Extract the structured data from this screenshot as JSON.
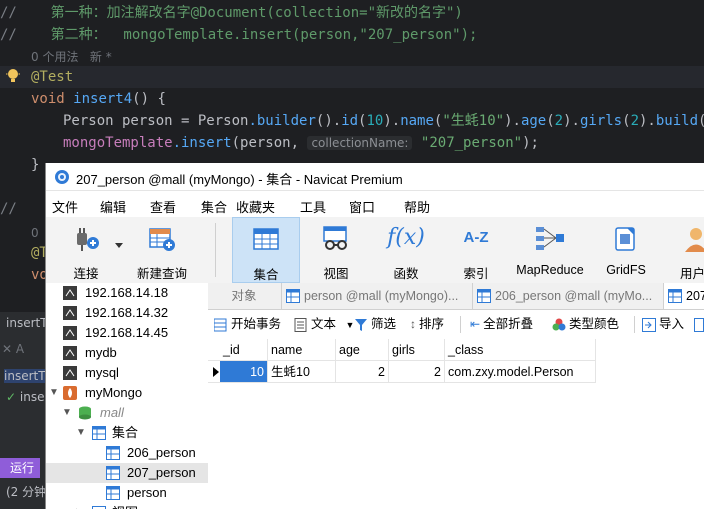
{
  "ide": {
    "line1": {
      "prefix": "//",
      "text": "    第一种：加注解改名字@Document(collection=\"新改的名字\")"
    },
    "line2": {
      "prefix": "//",
      "text": "    第二种：  mongoTemplate.insert(person,\"207_person\");"
    },
    "usage_hint": "0 个用法   新 *",
    "annotation": "@Test",
    "method_kw": "void",
    "method_name": "insert4",
    "method_tail": "() {",
    "stmt1": {
      "type": "Person",
      "var": " person = ",
      "cls": "Person",
      "builder": ".builder",
      "p1": "().",
      "id": "id",
      "id_val": "10",
      "p2": ").",
      "name": "name",
      "name_val": "\"生蚝10\"",
      "p3": ").",
      "age": "age",
      "age_val": "2",
      "p4": ").",
      "girls": "girls",
      "girls_val": "2",
      "p5": ").",
      "build": "build",
      "p6": "();"
    },
    "stmt2": {
      "obj": "mongoTemplate",
      "method": ".insert",
      "args": "(person, ",
      "inlay": "collectionName:",
      "str": " \"207_person\"",
      "end": ");"
    },
    "close_brace": "}",
    "frag_comment": "//",
    "frag_zero": "0",
    "frag_t": "@T",
    "frag_vo": "vo",
    "side_tab1": "insertT",
    "side_tab2": "insertT",
    "side_inse": "inse",
    "run_label": "运行",
    "run_hint": "(2 分钟"
  },
  "navicat": {
    "title": "207_person @mall (myMongo) - 集合 - Navicat Premium",
    "menu": [
      "文件",
      "编辑",
      "查看",
      "集合",
      "收藏夹",
      "工具",
      "窗口",
      "帮助"
    ],
    "toolbar": {
      "connect": "连接",
      "new_query": "新建查询",
      "collection": "集合",
      "view": "视图",
      "function": "函数",
      "index": "索引",
      "mapreduce": "MapReduce",
      "gridfs": "GridFS",
      "user": "用户"
    },
    "tree": [
      {
        "label": "192.168.14.18"
      },
      {
        "label": "192.168.14.32"
      },
      {
        "label": "192.168.14.45"
      },
      {
        "label": "mydb"
      },
      {
        "label": "mysql"
      },
      {
        "label": "myMongo"
      },
      {
        "label": "mall"
      },
      {
        "label": "集合"
      },
      {
        "label": "206_person"
      },
      {
        "label": "207_person"
      },
      {
        "label": "person"
      },
      {
        "label": "视图"
      }
    ],
    "tabs": {
      "objects": "对象",
      "tab1": "person @mall (myMongo)...",
      "tab2": "206_person @mall (myMo...",
      "tab3": "207"
    },
    "subtoolbar": {
      "begin_tx": "开始事务",
      "text": "文本",
      "filter": "筛选",
      "sort": "排序",
      "collapse_all": "全部折叠",
      "type_color": "类型颜色",
      "import": "导入"
    },
    "grid": {
      "columns": [
        "_id",
        "name",
        "age",
        "girls",
        "_class"
      ],
      "rows": [
        [
          "10",
          "生蚝10",
          "2",
          "2",
          "com.zxy.model.Person"
        ]
      ]
    }
  },
  "watermark": "CSDN @赵同学&"
}
